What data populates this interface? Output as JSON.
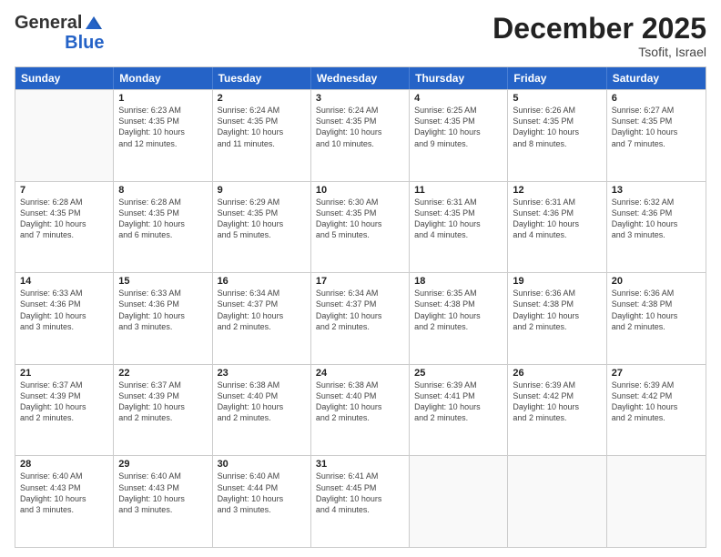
{
  "logo": {
    "general": "General",
    "blue": "Blue"
  },
  "title": "December 2025",
  "location": "Tsofit, Israel",
  "days_of_week": [
    "Sunday",
    "Monday",
    "Tuesday",
    "Wednesday",
    "Thursday",
    "Friday",
    "Saturday"
  ],
  "weeks": [
    [
      {
        "day": "",
        "info": ""
      },
      {
        "day": "1",
        "info": "Sunrise: 6:23 AM\nSunset: 4:35 PM\nDaylight: 10 hours\nand 12 minutes."
      },
      {
        "day": "2",
        "info": "Sunrise: 6:24 AM\nSunset: 4:35 PM\nDaylight: 10 hours\nand 11 minutes."
      },
      {
        "day": "3",
        "info": "Sunrise: 6:24 AM\nSunset: 4:35 PM\nDaylight: 10 hours\nand 10 minutes."
      },
      {
        "day": "4",
        "info": "Sunrise: 6:25 AM\nSunset: 4:35 PM\nDaylight: 10 hours\nand 9 minutes."
      },
      {
        "day": "5",
        "info": "Sunrise: 6:26 AM\nSunset: 4:35 PM\nDaylight: 10 hours\nand 8 minutes."
      },
      {
        "day": "6",
        "info": "Sunrise: 6:27 AM\nSunset: 4:35 PM\nDaylight: 10 hours\nand 7 minutes."
      }
    ],
    [
      {
        "day": "7",
        "info": "Sunrise: 6:28 AM\nSunset: 4:35 PM\nDaylight: 10 hours\nand 7 minutes."
      },
      {
        "day": "8",
        "info": "Sunrise: 6:28 AM\nSunset: 4:35 PM\nDaylight: 10 hours\nand 6 minutes."
      },
      {
        "day": "9",
        "info": "Sunrise: 6:29 AM\nSunset: 4:35 PM\nDaylight: 10 hours\nand 5 minutes."
      },
      {
        "day": "10",
        "info": "Sunrise: 6:30 AM\nSunset: 4:35 PM\nDaylight: 10 hours\nand 5 minutes."
      },
      {
        "day": "11",
        "info": "Sunrise: 6:31 AM\nSunset: 4:35 PM\nDaylight: 10 hours\nand 4 minutes."
      },
      {
        "day": "12",
        "info": "Sunrise: 6:31 AM\nSunset: 4:36 PM\nDaylight: 10 hours\nand 4 minutes."
      },
      {
        "day": "13",
        "info": "Sunrise: 6:32 AM\nSunset: 4:36 PM\nDaylight: 10 hours\nand 3 minutes."
      }
    ],
    [
      {
        "day": "14",
        "info": "Sunrise: 6:33 AM\nSunset: 4:36 PM\nDaylight: 10 hours\nand 3 minutes."
      },
      {
        "day": "15",
        "info": "Sunrise: 6:33 AM\nSunset: 4:36 PM\nDaylight: 10 hours\nand 3 minutes."
      },
      {
        "day": "16",
        "info": "Sunrise: 6:34 AM\nSunset: 4:37 PM\nDaylight: 10 hours\nand 2 minutes."
      },
      {
        "day": "17",
        "info": "Sunrise: 6:34 AM\nSunset: 4:37 PM\nDaylight: 10 hours\nand 2 minutes."
      },
      {
        "day": "18",
        "info": "Sunrise: 6:35 AM\nSunset: 4:38 PM\nDaylight: 10 hours\nand 2 minutes."
      },
      {
        "day": "19",
        "info": "Sunrise: 6:36 AM\nSunset: 4:38 PM\nDaylight: 10 hours\nand 2 minutes."
      },
      {
        "day": "20",
        "info": "Sunrise: 6:36 AM\nSunset: 4:38 PM\nDaylight: 10 hours\nand 2 minutes."
      }
    ],
    [
      {
        "day": "21",
        "info": "Sunrise: 6:37 AM\nSunset: 4:39 PM\nDaylight: 10 hours\nand 2 minutes."
      },
      {
        "day": "22",
        "info": "Sunrise: 6:37 AM\nSunset: 4:39 PM\nDaylight: 10 hours\nand 2 minutes."
      },
      {
        "day": "23",
        "info": "Sunrise: 6:38 AM\nSunset: 4:40 PM\nDaylight: 10 hours\nand 2 minutes."
      },
      {
        "day": "24",
        "info": "Sunrise: 6:38 AM\nSunset: 4:40 PM\nDaylight: 10 hours\nand 2 minutes."
      },
      {
        "day": "25",
        "info": "Sunrise: 6:39 AM\nSunset: 4:41 PM\nDaylight: 10 hours\nand 2 minutes."
      },
      {
        "day": "26",
        "info": "Sunrise: 6:39 AM\nSunset: 4:42 PM\nDaylight: 10 hours\nand 2 minutes."
      },
      {
        "day": "27",
        "info": "Sunrise: 6:39 AM\nSunset: 4:42 PM\nDaylight: 10 hours\nand 2 minutes."
      }
    ],
    [
      {
        "day": "28",
        "info": "Sunrise: 6:40 AM\nSunset: 4:43 PM\nDaylight: 10 hours\nand 3 minutes."
      },
      {
        "day": "29",
        "info": "Sunrise: 6:40 AM\nSunset: 4:43 PM\nDaylight: 10 hours\nand 3 minutes."
      },
      {
        "day": "30",
        "info": "Sunrise: 6:40 AM\nSunset: 4:44 PM\nDaylight: 10 hours\nand 3 minutes."
      },
      {
        "day": "31",
        "info": "Sunrise: 6:41 AM\nSunset: 4:45 PM\nDaylight: 10 hours\nand 4 minutes."
      },
      {
        "day": "",
        "info": ""
      },
      {
        "day": "",
        "info": ""
      },
      {
        "day": "",
        "info": ""
      }
    ]
  ]
}
